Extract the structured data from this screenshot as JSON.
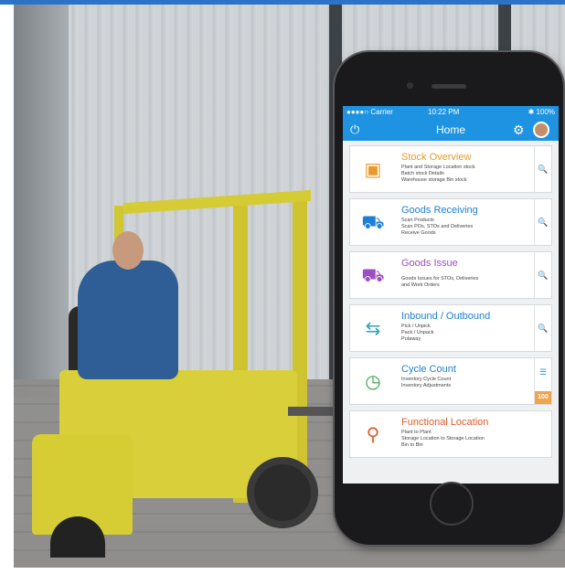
{
  "status_bar": {
    "carrier": "●●●●○ Carrier",
    "time": "10:22 PM",
    "battery": "✱ 100%"
  },
  "nav": {
    "title": "Home",
    "power_icon": "power-icon",
    "gear_icon": "gear-icon",
    "avatar": "avatar"
  },
  "colors": {
    "accent": "#1e93e2",
    "stock": "#e89a2c",
    "receiving": "#1e7fd6",
    "issue": "#9b4fc2",
    "inbound": "#2aa3b8",
    "cycle": "#3aa14a",
    "functional": "#e05a2a",
    "badge": "#f0a54a"
  },
  "tiles": [
    {
      "title": "Stock Overview",
      "lines": [
        "Plant and Storage Location stock",
        "Batch stock Details",
        "Warehouse storage Bin stock"
      ],
      "icon": "boxes-icon",
      "action": "search-icon"
    },
    {
      "title": "Goods Receiving",
      "lines": [
        "Scan Products",
        "Scan POs, STOs and Deliveries",
        "Receive Goods"
      ],
      "icon": "truck-icon",
      "action": "search-icon"
    },
    {
      "title": "Goods Issue",
      "lines": [
        "Goods Issues for STOs, Deliveries",
        "and Work Orders"
      ],
      "icon": "hand-truck-icon",
      "action": "search-icon"
    },
    {
      "title": "Inbound / Outbound",
      "lines": [
        "Pick / Unpick",
        "Pack / Unpack",
        "Putaway"
      ],
      "icon": "inbound-outbound-icon",
      "action": "search-icon"
    },
    {
      "title": "Cycle Count",
      "lines": [
        "Inventory Cycle Count",
        "Inventory Adjustments"
      ],
      "icon": "count-clock-icon",
      "action": "list-icon",
      "badge": "100"
    },
    {
      "title": "Functional Location",
      "lines": [
        "Plant to Plant",
        "Storage Location to Storage Location",
        "Bin to Bin"
      ],
      "icon": "location-pins-icon"
    }
  ]
}
